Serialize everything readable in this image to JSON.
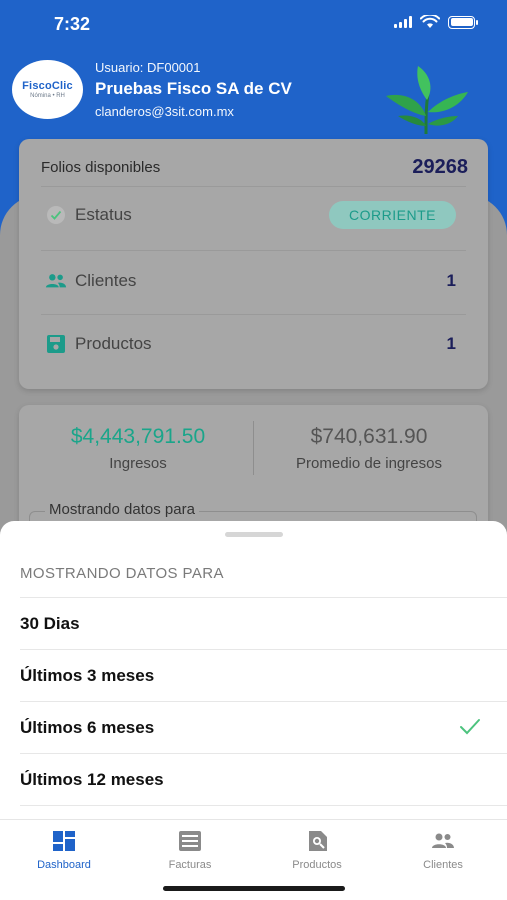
{
  "status_bar": {
    "time": "7:32"
  },
  "header": {
    "logo_main": "FiscoClic",
    "logo_sub": "Nómina • RH",
    "user_id": "Usuario: DF00001",
    "company": "Pruebas Fisco SA de CV",
    "email": "clanderos@3sit.com.mx"
  },
  "summary": {
    "folios_label": "Folios disponibles",
    "folios_value": "29268",
    "status_label": "Estatus",
    "status_badge": "CORRIENTE",
    "clients_label": "Clientes",
    "clients_value": "1",
    "products_label": "Productos",
    "products_value": "1"
  },
  "income": {
    "income_value": "$4,443,791.50",
    "income_label": "Ingresos",
    "avg_value": "$740,631.90",
    "avg_label": "Promedio de ingresos",
    "showing_label": "Mostrando datos para"
  },
  "sheet": {
    "title": "MOSTRANDO DATOS PARA",
    "options": [
      {
        "label": "30 Dias"
      },
      {
        "label": "Últimos 3 meses"
      },
      {
        "label": "Últimos 6 meses",
        "selected": true
      },
      {
        "label": "Últimos 12 meses"
      }
    ]
  },
  "tabs": [
    {
      "label": "Dashboard",
      "active": true
    },
    {
      "label": "Facturas"
    },
    {
      "label": "Productos"
    },
    {
      "label": "Clientes"
    }
  ],
  "colors": {
    "brand_blue": "#1f63c9",
    "accent_teal": "#1c9b8a",
    "income_green": "#1aa58a",
    "dark_navy": "#1b1e5a",
    "check_green": "#4cc37e"
  }
}
